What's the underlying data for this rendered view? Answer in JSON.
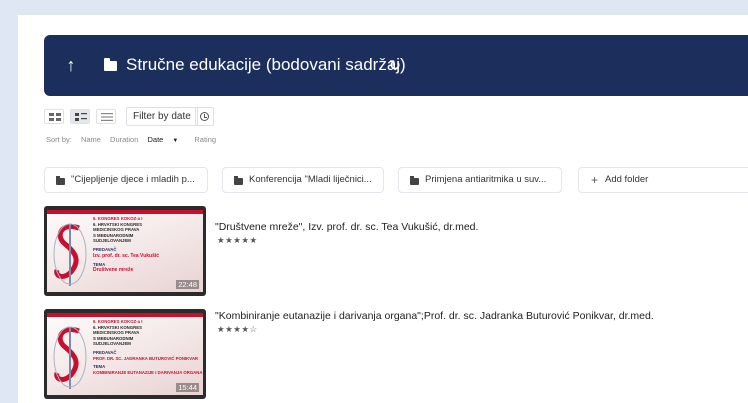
{
  "header": {
    "back_icon": "up-arrow-icon",
    "folder_icon": "folder-icon",
    "title": "Stručne edukacije (bodovani sadržaj)",
    "refresh_icon": "refresh-icon",
    "background_color": "#1c2e5c"
  },
  "toolbar": {
    "view_modes": [
      "grid",
      "detailed-list",
      "list"
    ],
    "active_view": "detailed-list",
    "filter_label": "Filter by date",
    "history_icon": "clock-icon"
  },
  "sort": {
    "label": "Sort by:",
    "options": [
      "Name",
      "Duration",
      "Date",
      "Rating"
    ],
    "active": "Date",
    "direction_glyph": "▼"
  },
  "folders": [
    {
      "label": "\"Cijepljenje djece i mladih p..."
    },
    {
      "label": "Konferencija \"Mladi liječnici..."
    },
    {
      "label": "Primjena antiaritmika u suv..."
    }
  ],
  "add_folder": {
    "label": "Add folder",
    "icon": "plus-icon"
  },
  "videos": [
    {
      "title": "\"Društvene mreže\", Izv. prof. dr. sc. Tea Vukušić, dr.med.",
      "rating": 5,
      "rating_display": "★★★★★",
      "duration": "22:48",
      "thumbnail": {
        "lines": [
          "6. KONGRES KOKOZ-a I",
          "6. HRVATSKI KONGRES",
          "MEDICINSKOG PRAVA",
          "S MEĐUNARODNIM",
          "SUDJELOVANJEM"
        ],
        "presenter_label": "PREDAVAČ",
        "presenter": "Izv. prof. dr. sc. Tea Vukušić",
        "topic_label": "TEMA",
        "topic": "Društvene mreže"
      }
    },
    {
      "title": "\"Kombiniranje eutanazije i darivanja organa\";Prof. dr. sc. Jadranka Buturović Ponikvar, dr.med.",
      "rating": 4,
      "rating_display": "★★★★☆",
      "duration": "15:44",
      "thumbnail": {
        "lines": [
          "6. KONGRES KOKOZ-a I",
          "6. HRVATSKI KONGRES",
          "MEDICINSKOG PRAVA",
          "S MEĐUNARODNIM",
          "SUDJELOVANJEM"
        ],
        "presenter_label": "PREDAVAČ",
        "presenter": "PROF. DR. SC. JADRANKA BUTUROVIĆ PONIKVAR",
        "topic_label": "TEMA",
        "topic": "KOMBINIRANJE EUTANAZIJE I DARIVANJA ORGANA"
      }
    }
  ],
  "colors": {
    "page_background": "#dfe6f4",
    "accent_red": "#c8102e"
  }
}
